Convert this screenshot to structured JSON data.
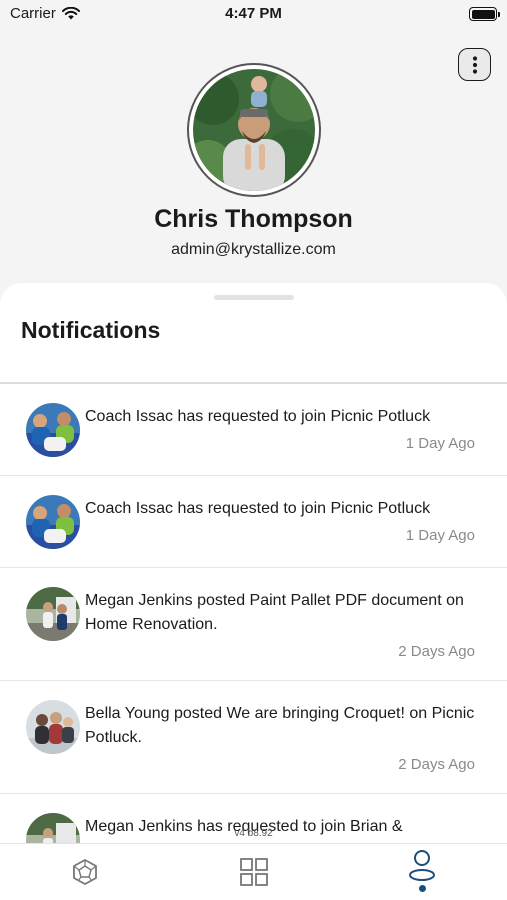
{
  "status_bar": {
    "carrier": "Carrier",
    "time": "4:47 PM"
  },
  "profile": {
    "name": "Chris Thompson",
    "email": "admin@krystallize.com"
  },
  "notifications": {
    "title": "Notifications",
    "items": [
      {
        "text": "Coach Issac has requested to join Picnic Potluck",
        "time": "1 Day Ago",
        "avatar": "group-avatar-blue"
      },
      {
        "text": "Coach Issac has requested to join Picnic Potluck",
        "time": "1 Day Ago",
        "avatar": "group-avatar-blue"
      },
      {
        "text": "Megan Jenkins posted Paint Pallet PDF document on Home Renovation.",
        "time": "2 Days Ago",
        "avatar": "group-avatar-outdoor"
      },
      {
        "text": "Bella Young posted We are bringing Croquet! on Picnic Potluck.",
        "time": "2 Days Ago",
        "avatar": "group-avatar-people"
      },
      {
        "text": "Megan Jenkins has requested to join Brian &",
        "time": "",
        "avatar": "group-avatar-outdoor"
      }
    ]
  },
  "footer": {
    "version": "v4 b8.92"
  },
  "tab_bar": {
    "tabs": [
      {
        "icon": "dodecahedron-icon",
        "active": false
      },
      {
        "icon": "grid-icon",
        "active": false
      },
      {
        "icon": "profile-icon",
        "active": true
      }
    ]
  },
  "colors": {
    "accent": "#1d4f7c",
    "background": "#f4f4f4",
    "muted_text": "#8a8a8a"
  }
}
